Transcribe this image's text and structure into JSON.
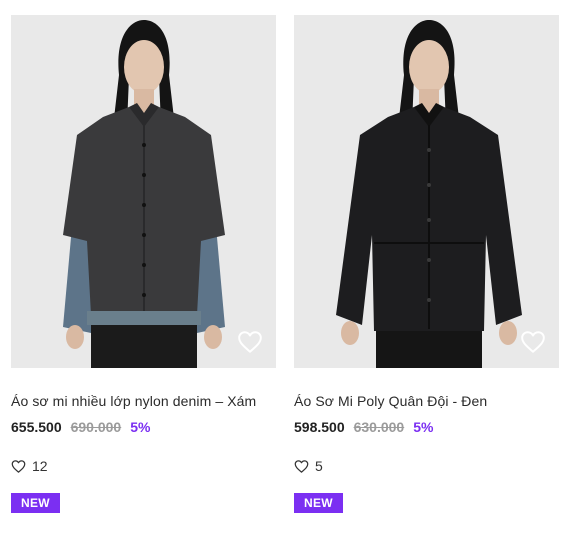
{
  "products": [
    {
      "name": "Áo sơ mi nhiều lớp nylon denim – Xám",
      "price": "655.500",
      "old_price": "690.000",
      "discount": "5%",
      "likes": "12",
      "badge": "NEW",
      "colors": {
        "shirt": "#3a3a3c",
        "sleeve": "#5d7489",
        "pants": "#1b1b1b"
      }
    },
    {
      "name": "Áo Sơ Mi Poly Quân Đội - Đen",
      "price": "598.500",
      "old_price": "630.000",
      "discount": "5%",
      "likes": "5",
      "badge": "NEW",
      "colors": {
        "shirt": "#1d1d1f",
        "sleeve": "#1d1d1f",
        "pants": "#151515"
      }
    }
  ],
  "colors": {
    "accent": "#7b2ff2",
    "old_price": "#9b9b9b"
  },
  "icons": {
    "favorite": "heart-outline-icon",
    "like": "heart-outline-icon"
  }
}
